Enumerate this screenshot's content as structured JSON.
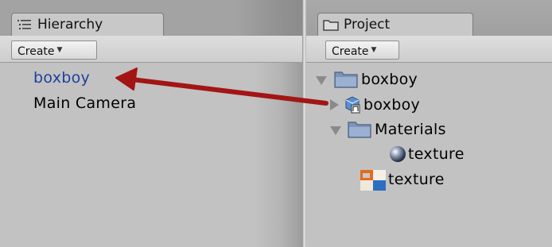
{
  "hierarchy": {
    "tab_label": "Hierarchy",
    "create_label": "Create",
    "items": [
      {
        "label": "boxboy",
        "selected": true
      },
      {
        "label": "Main Camera",
        "selected": false
      }
    ]
  },
  "project": {
    "tab_label": "Project",
    "create_label": "Create",
    "tree": [
      {
        "label": "boxboy",
        "icon": "folder-icon",
        "expanded": true,
        "depth": 0
      },
      {
        "label": "boxboy",
        "icon": "prefab-model-icon",
        "expanded": false,
        "depth": 1
      },
      {
        "label": "Materials",
        "icon": "folder-icon",
        "expanded": true,
        "depth": 1
      },
      {
        "label": "texture",
        "icon": "material-sphere-icon",
        "depth": 2
      },
      {
        "label": "texture",
        "icon": "texture-icon",
        "depth": 1
      }
    ]
  },
  "annotation": {
    "arrow_color": "#a31515"
  },
  "colors": {
    "panel_bg": "#c2c2c2",
    "selected_text": "#1f3fa0",
    "folder": "#7e95ba"
  }
}
